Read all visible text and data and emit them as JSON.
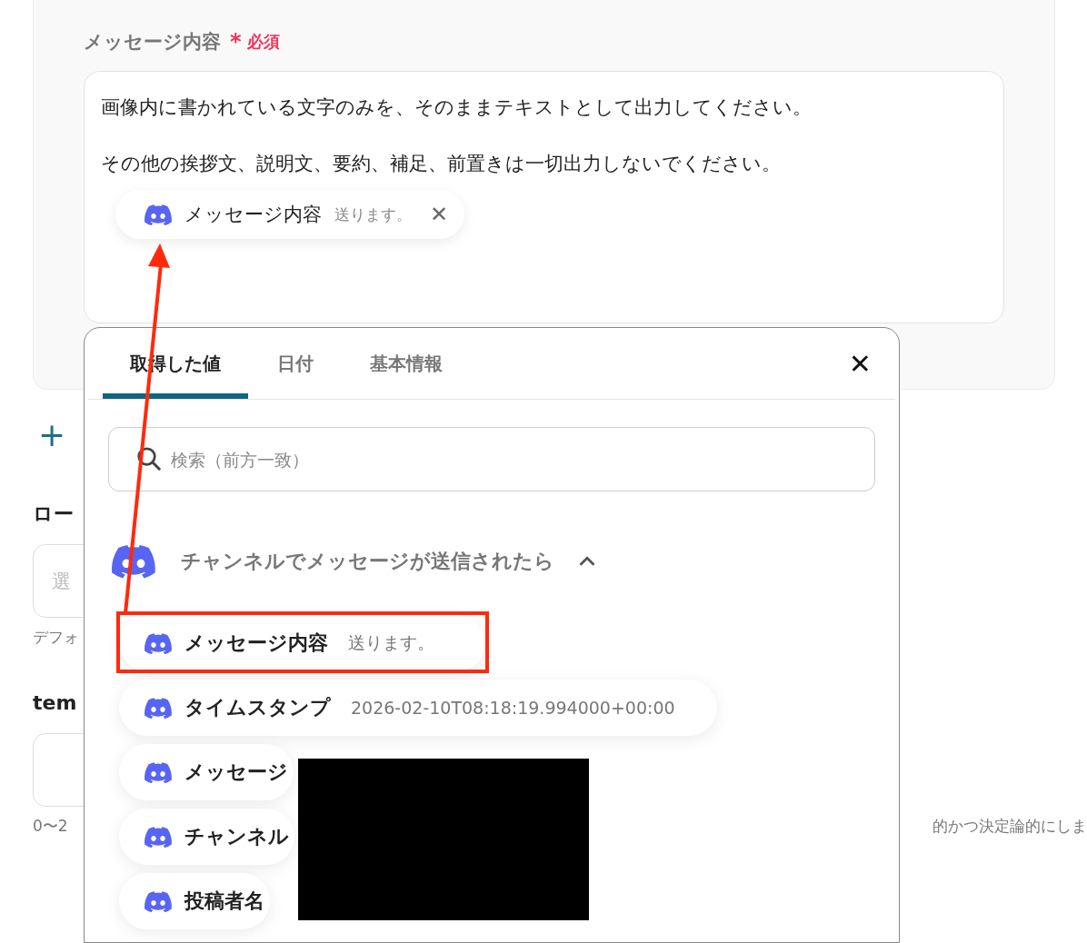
{
  "field": {
    "label": "メッセージ内容",
    "required_mark": "*",
    "required": "必須",
    "lines": [
      "画像内に書かれている文字のみを、そのままテキストとして出力してください。",
      "その他の挨拶文、説明文、要約、補足、前置きは一切出力しないでください。"
    ],
    "chip": {
      "name": "メッセージ内容",
      "value": "送ります。",
      "remove": "✕"
    }
  },
  "add_button": "+",
  "settings": [
    {
      "label": "ロー",
      "placeholder": "選",
      "hint": "デフォ"
    },
    {
      "label": "tem",
      "hint": "0〜2",
      "hint_tail": "的かつ決定論的にしま"
    }
  ],
  "picker": {
    "tabs": [
      {
        "label": "取得した値",
        "selected": true
      },
      {
        "label": "日付",
        "selected": false
      },
      {
        "label": "基本情報",
        "selected": false
      }
    ],
    "close": "✕",
    "search": {
      "placeholder": "検索（前方一致）"
    },
    "group": {
      "title": "チャンネルでメッセージが送信されたら",
      "expanded": true
    },
    "items": [
      {
        "name": "メッセージ内容",
        "value": "送ります。",
        "highlighted": true
      },
      {
        "name": "タイムスタンプ",
        "value": "2026-02-10T08:18:19.994000+00:00",
        "highlighted": false
      },
      {
        "name": "メッセージ",
        "highlighted": false
      },
      {
        "name": "チャンネル",
        "highlighted": false
      },
      {
        "name": "投稿者名",
        "highlighted": false
      }
    ]
  }
}
